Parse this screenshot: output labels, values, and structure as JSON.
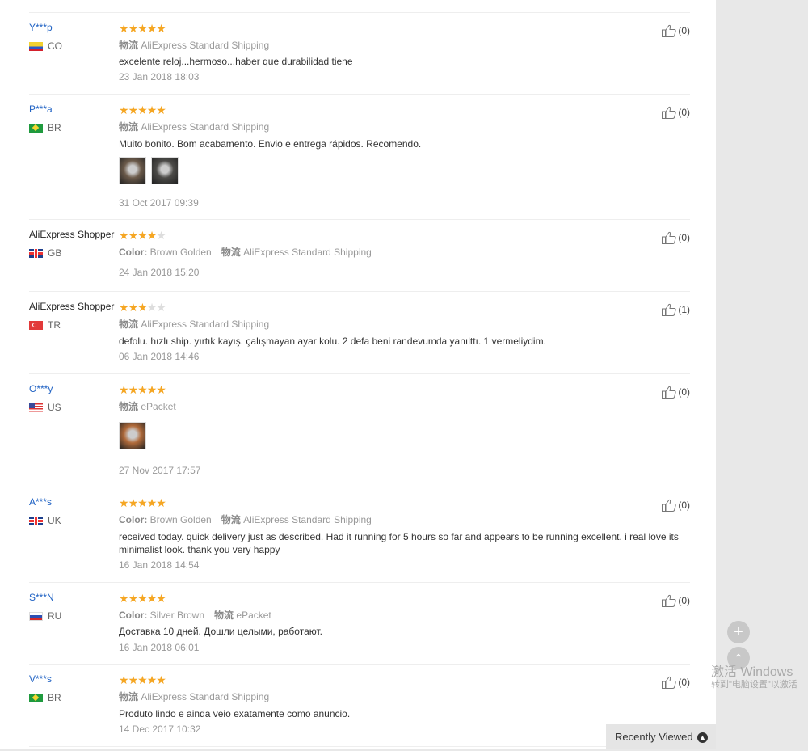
{
  "reviews": [
    {
      "user": "Y***p",
      "masked": true,
      "country": "CO",
      "stars": 5,
      "attrs": [
        {
          "key": "物流",
          "value": "AliExpress Standard Shipping"
        }
      ],
      "text": "excelente reloj...hermoso...haber que durabilidad tiene",
      "photos": [],
      "date": "23 Jan 2018 18:03",
      "helpful": "(0)"
    },
    {
      "user": "P***a",
      "masked": true,
      "country": "BR",
      "stars": 5,
      "attrs": [
        {
          "key": "物流",
          "value": "AliExpress Standard Shipping"
        }
      ],
      "text": "Muito bonito. Bom acabamento. Envio e entrega rápidos. Recomendo.",
      "photos": [
        "#6b5a4a",
        "#4b4a47"
      ],
      "date": "31 Oct 2017 09:39",
      "helpful": "(0)"
    },
    {
      "user": "AliExpress Shopper",
      "masked": false,
      "country": "GB",
      "stars": 4,
      "attrs": [
        {
          "key": "Color:",
          "value": "Brown Golden"
        },
        {
          "key": "物流",
          "value": "AliExpress Standard Shipping"
        }
      ],
      "text": "",
      "photos": [],
      "date": "24 Jan 2018 15:20",
      "helpful": "(0)"
    },
    {
      "user": "AliExpress Shopper",
      "masked": false,
      "country": "TR",
      "stars": 3,
      "attrs": [
        {
          "key": "物流",
          "value": "AliExpress Standard Shipping"
        }
      ],
      "text": "defolu. hızlı ship. yırtık kayış. çalışmayan ayar kolu. 2 defa beni randevumda yanılttı. 1 vermeliydim.",
      "photos": [],
      "date": "06 Jan 2018 14:46",
      "helpful": "(1)"
    },
    {
      "user": "O***y",
      "masked": true,
      "country": "US",
      "stars": 5,
      "attrs": [
        {
          "key": "物流",
          "value": "ePacket"
        }
      ],
      "text": "",
      "photos": [
        "#b06a3a"
      ],
      "date": "27 Nov 2017 17:57",
      "helpful": "(0)"
    },
    {
      "user": "A***s",
      "masked": true,
      "country": "UK",
      "flag": "GB",
      "stars": 5,
      "attrs": [
        {
          "key": "Color:",
          "value": "Brown Golden"
        },
        {
          "key": "物流",
          "value": "AliExpress Standard Shipping"
        }
      ],
      "text": "received today. quick delivery just as described. Had it running for 5 hours so far and appears to be running excellent. i real love its minimalist look. thank you very happy",
      "photos": [],
      "date": "16 Jan 2018 14:54",
      "helpful": "(0)"
    },
    {
      "user": "S***N",
      "masked": true,
      "country": "RU",
      "stars": 5,
      "attrs": [
        {
          "key": "Color:",
          "value": "Silver Brown"
        },
        {
          "key": "物流",
          "value": "ePacket"
        }
      ],
      "text": "Доставка 10 дней. Дошли целыми, работают.",
      "photos": [],
      "date": "16 Jan 2018 06:01",
      "helpful": "(0)"
    },
    {
      "user": "V***s",
      "masked": true,
      "country": "BR",
      "stars": 5,
      "attrs": [
        {
          "key": "物流",
          "value": "AliExpress Standard Shipping"
        }
      ],
      "text": "Produto lindo e ainda veio exatamente como anuncio.",
      "photos": [],
      "date": "14 Dec 2017 10:32",
      "helpful": "(0)"
    }
  ],
  "side": {
    "plus": "+",
    "up": "⌃"
  },
  "watermark": {
    "line1": "激活 Windows",
    "line2": "转到\"电脑设置\"以激活"
  },
  "recently_viewed": {
    "label": "Recently Viewed",
    "icon": "chevron-up-icon"
  },
  "colors": {
    "star": "#f5a623",
    "username": "#2163c4"
  }
}
